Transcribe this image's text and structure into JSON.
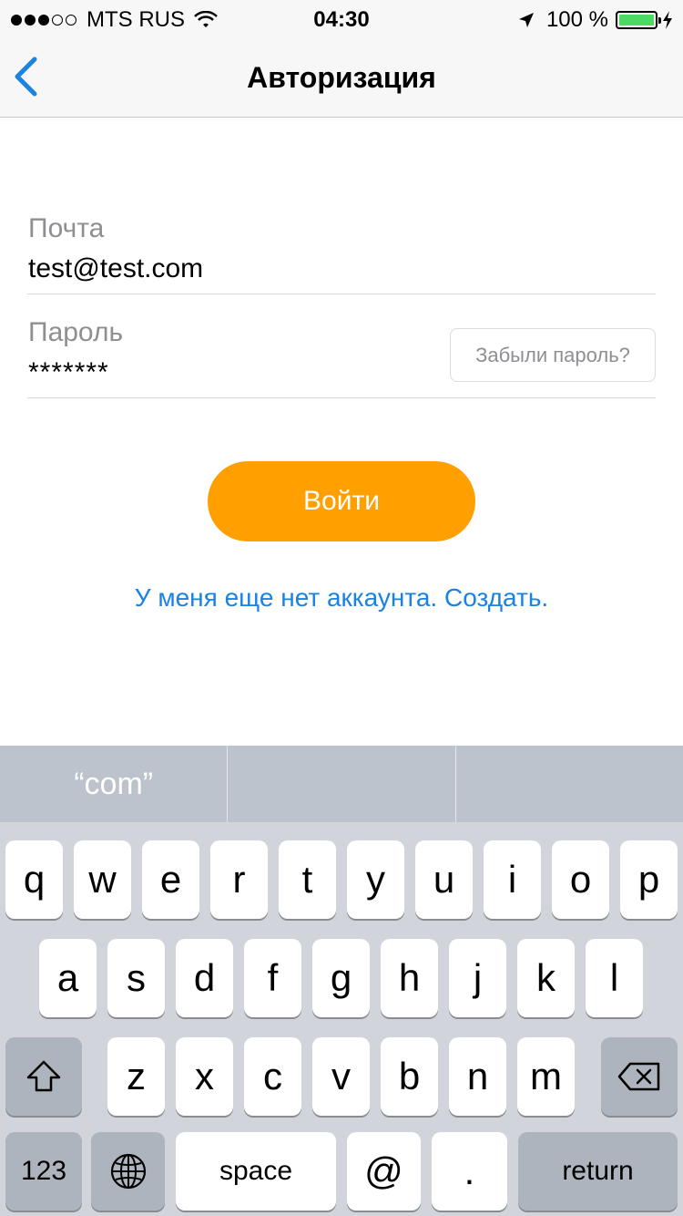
{
  "status_bar": {
    "carrier": "MTS RUS",
    "time": "04:30",
    "battery_percent": "100 %",
    "signal_bars_filled": 3,
    "signal_bars_total": 5
  },
  "nav": {
    "title": "Авторизация",
    "back_icon": "chevron-left-icon"
  },
  "form": {
    "email_label": "Почта",
    "email_value": "test@test.com",
    "password_label": "Пароль",
    "password_value": "*******",
    "forgot_label": "Забыли пароль?"
  },
  "login_button": "Войти",
  "signup_link": "У меня еще нет аккаунта. Создать.",
  "colors": {
    "accent": "#ff9f00",
    "link": "#1a82e2",
    "battery": "#4cd964"
  },
  "keyboard": {
    "suggestions": [
      "“com”",
      "",
      ""
    ],
    "row1": [
      "q",
      "w",
      "e",
      "r",
      "t",
      "y",
      "u",
      "i",
      "o",
      "p"
    ],
    "row2": [
      "a",
      "s",
      "d",
      "f",
      "g",
      "h",
      "j",
      "k",
      "l"
    ],
    "row3": [
      "z",
      "x",
      "c",
      "v",
      "b",
      "n",
      "m"
    ],
    "numbers_key": "123",
    "space_key": "space",
    "at_key": "@",
    "dot_key": ".",
    "return_key": "return"
  }
}
